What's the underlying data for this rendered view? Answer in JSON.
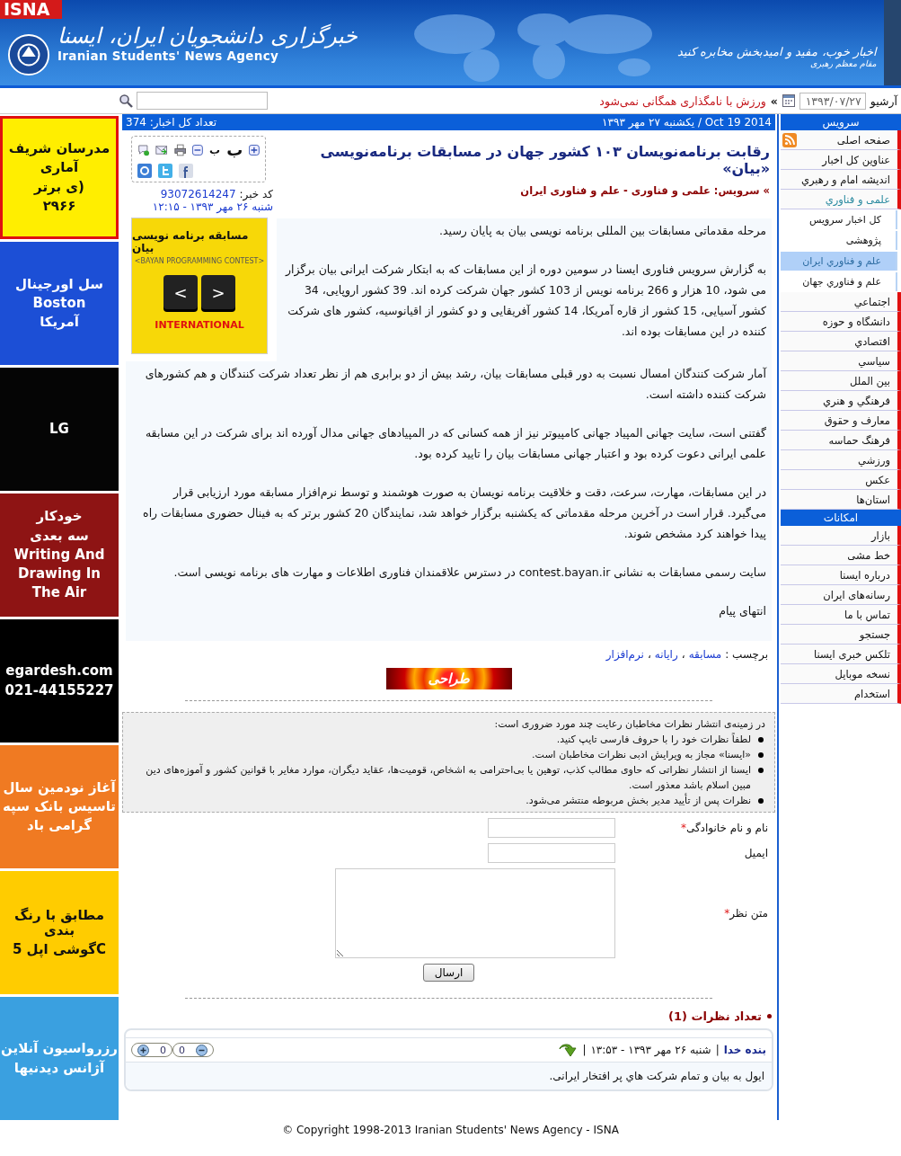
{
  "header": {
    "tab": "ISNA",
    "title": "خبرگزاری دانشجویان ایران، ایسنا",
    "subtitle": "Iranian Students' News Agency",
    "quote": "اخبار خوب، مفید و امیدبخش مخابره کنید",
    "quote_author": "مقام معظم رهبری"
  },
  "topbar": {
    "archive_label": "آرشیو",
    "archive_date": "۱۳۹۳/۰۷/۲۷",
    "ticker_mark": "»",
    "ticker": "ورزش با نامگذاری همگانی نمی‌شود"
  },
  "infobar": {
    "total": "تعداد کل اخبار: 374",
    "date": "یکشنبه ۲۷ مهر ۱۳۹۳ / Oct 19 2014"
  },
  "ads": [
    {
      "color": "#ffee00",
      "lines": [
        "مدرسان شریف",
        "آماری",
        "ی برتر)",
        "۲۹۶۶"
      ]
    },
    {
      "color": "#1c4fd6",
      "lines": [
        "سل اورجینال",
        "Boston",
        "آمریکا"
      ]
    },
    {
      "color": "#050505",
      "lines": [
        "LG"
      ]
    },
    {
      "color": "#8e1414",
      "lines": [
        "خودکار",
        "سه بعدی",
        "Writing And",
        "Drawing In",
        "The Air"
      ]
    },
    {
      "color": "#000000",
      "lines": [
        "egardesh.com",
        "021-44155227"
      ]
    },
    {
      "color": "#f07a22",
      "lines": [
        "آغاز نودمین سال",
        "تاسیس بانک سپه",
        "گرامی باد"
      ]
    },
    {
      "color": "#ffcc00",
      "lines": [
        "مطابق با رنگ بندی",
        "گوشی اپل 5C"
      ]
    },
    {
      "color": "#3aa0e0",
      "lines": [
        "رزرواسیون آنلاین",
        "آژانس دیدنیها"
      ]
    }
  ],
  "article": {
    "font_small": "ب",
    "font_large": "ب",
    "title": "رقابت برنامه‌نویسان ۱۰۳ کشور جهان در مسابقات برنامه‌نویسی «بیان»",
    "service": "» سرویس: علمی و فناوری - علم و فناوری ایران",
    "code_label": "کد خبر:",
    "code": "93072614247",
    "date": "شنبه ۲۶ مهر ۱۳۹۳ - ۱۲:۱۵",
    "image": {
      "title": "مسابقه برنامه نویسی بیان",
      "subtitle": "<BAYAN PROGRAMMING CONTEST>",
      "key_left": "<",
      "key_right": ">",
      "caption": "INTERNATIONAL"
    },
    "paragraphs": [
      "مرحله مقدماتی مسابقات بین المللی برنامه نویسی بیان به پایان رسید.",
      "به گزارش سرویس فناوری ایسنا در سومین دوره از این مسابقات که به ابتکار شرکت ایرانی بیان برگزار می شود، 10 هزار و 266 برنامه نویس از 103 کشور جهان شرکت کرده اند. 39 کشور اروپایی، 34 کشور آسیایی، 15 کشور از قاره آمریکا، 14 کشور آفریقایی و دو کشور از اقیانوسیه، کشور های شرکت کننده در این مسابقات بوده اند.",
      "آمار شرکت کنندگان امسال نسبت به دور قبلی مسابقات بیان، رشد بیش از دو برابری هم از نظر تعداد شرکت کنندگان و هم کشورهای شرکت کننده داشته است.",
      "گفتنی است، سایت جهانی المپیاد جهانی کامپیوتر نیز از همه کسانی که در المپیادهای جهانی مدال آورده اند برای شرکت در این مسابقه علمی ایرانی دعوت کرده بود و اعتبار جهانی مسابقات بیان را تایید کرده بود.",
      "در این مسابقات، مهارت، سرعت، دقت و خلاقیت برنامه نویسان به صورت هوشمند و توسط نرم‌افزار مسابقه مورد ارزیابی قرار می‌گیرد. قرار است در آخرین مرحله مقدماتی که یکشنبه برگزار خواهد شد، نمایندگان 20 کشور برتر که به فینال حضوری مسابقات راه پیدا خواهند کرد مشخص شوند.",
      "سایت رسمی مسابقات به نشانی contest.bayan.ir در دسترس علاقمندان فناوری اطلاعات و مهارت های برنامه نویسی است.",
      "انتهای پیام"
    ],
    "tags_label": "برچسب :",
    "tags_separator": "،",
    "tags": [
      "مسابقه",
      "رایانه",
      "نرم‌افزار"
    ],
    "banner": "طراحی"
  },
  "rules": {
    "title": "در زمینه‌ی انتشار نظرات مخاطبان رعایت چند مورد ضروری است:",
    "items": [
      "لطفاً نظرات خود را با حروف فارسی تایپ کنید.",
      "«ایسنا» مجاز به ویرایش ادبی نظرات مخاطبان است.",
      "ایسنا از انتشار نظراتی که حاوی مطالب کذب، توهین یا بی‌احترامی به اشخاص، قومیت‌ها، عقاید دیگران، موارد مغایر با قوانین کشور و آموزه‌های دین مبین اسلام باشد معذور است.",
      "نظرات پس از تأیید مدیر بخش مربوطه منتشر می‌شود."
    ]
  },
  "form": {
    "required_mark": "*",
    "fields": [
      {
        "kind": "text",
        "label": "نام و نام خانوادگی",
        "required": true
      },
      {
        "kind": "text",
        "label": "ایمیل",
        "required": false
      },
      {
        "kind": "textarea",
        "label": "متن نظر",
        "required": true
      }
    ],
    "submit": "ارسال"
  },
  "comments": {
    "count": "تعداد نظرات (1)",
    "items": [
      {
        "author": "بنده خدا",
        "separator": "|",
        "date": "شنبه ۲۶ مهر ۱۳۹۳ - ۱۳:۵۳",
        "plus": "0",
        "minus": "0",
        "text": "ایول به بیان و تمام شرکت هاي پر افتخار ایرانی."
      }
    ]
  },
  "sidebar": [
    {
      "title": "سرویس",
      "items": [
        {
          "kind": "feed",
          "label": "صفحه اصلی",
          "selected": false
        },
        {
          "kind": "link",
          "label": "عناوین کل اخبار",
          "selected": false
        },
        {
          "kind": "link",
          "label": "اندیشه امام و رهبري",
          "selected": false
        },
        {
          "kind": "link",
          "label": "علمی و فناوري",
          "selected": true,
          "children": [
            {
              "label": "کل اخبار سرويس",
              "selected": false
            },
            {
              "label": "پژوهشی",
              "selected": false
            },
            {
              "label": "علم و فناوري ايران",
              "selected": true
            },
            {
              "label": "علم و فناوري جهان",
              "selected": false
            }
          ]
        },
        {
          "kind": "link",
          "label": "اجتماعي",
          "selected": false
        },
        {
          "kind": "link",
          "label": "دانشگاه و حوزه",
          "selected": false
        },
        {
          "kind": "link",
          "label": "اقتصادي",
          "selected": false
        },
        {
          "kind": "link",
          "label": "سياسي",
          "selected": false
        },
        {
          "kind": "link",
          "label": "بين الملل",
          "selected": false
        },
        {
          "kind": "link",
          "label": "فرهنگي و هنري",
          "selected": false
        },
        {
          "kind": "link",
          "label": "معارف و حقوق",
          "selected": false
        },
        {
          "kind": "link",
          "label": "فرهنگ حماسه",
          "selected": false
        },
        {
          "kind": "link",
          "label": "ورزشي",
          "selected": false
        },
        {
          "kind": "link",
          "label": "عكس",
          "selected": false
        },
        {
          "kind": "link",
          "label": "استان‌ها",
          "selected": false
        }
      ]
    },
    {
      "title": "امکانات",
      "items": [
        {
          "kind": "link",
          "label": "بازار",
          "selected": false
        },
        {
          "kind": "link",
          "label": "خط مشی",
          "selected": false
        },
        {
          "kind": "link",
          "label": "درباره ایسنا",
          "selected": false
        },
        {
          "kind": "link",
          "label": "رسانه‌های ایران",
          "selected": false
        },
        {
          "kind": "link",
          "label": "تماس با ما",
          "selected": false
        },
        {
          "kind": "link",
          "label": "جستجو",
          "selected": false
        },
        {
          "kind": "link",
          "label": "تلکس خبری ایسنا",
          "selected": false
        },
        {
          "kind": "link",
          "label": "نسخه موبایل",
          "selected": false
        },
        {
          "kind": "link",
          "label": "استخدام",
          "selected": false
        }
      ]
    }
  ],
  "footer": "© Copyright 1998-2013 Iranian Students' News Agency - ISNA"
}
